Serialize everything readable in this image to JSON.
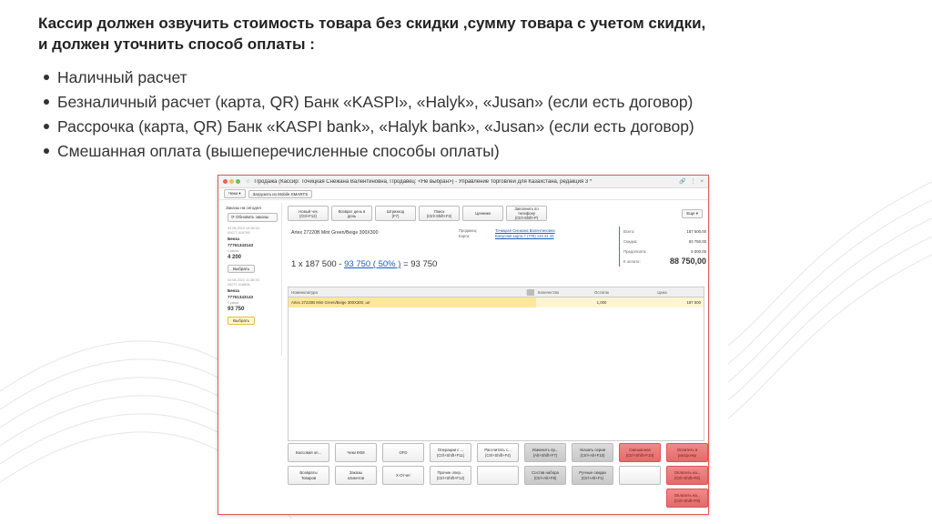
{
  "slide": {
    "title_line1": "Кассир должен озвучить стоимость товара без скидки ,сумму товара с учетом скидки,",
    "title_line2": "и должен уточнить способ оплаты :",
    "bullets": [
      "Наличный расчет",
      "Безналичный расчет (карта, QR) Банк «KASPI», «Halyk», «Jusan» (если есть договор)",
      "Рассрочка (карта, QR) Банк «KASPI bank», «Halyk bank», «Jusan» (если есть договор)",
      "Смешанная оплата (вышеперечисленные способы оплаты)"
    ]
  },
  "window": {
    "title": "Продажа (Кассир: Точицкая Снежана Валентиновна, Продавец: <Не выбран>) - Управление торговлей для Казахстана, редакция 3 *",
    "toolbar": {
      "checks": "Чеки ▾",
      "load_mobile": "Загрузить из Mobile SMARTS"
    },
    "left": {
      "title": "Заказы на сегодня",
      "refresh": "⟳  Обновить заказы",
      "orders": [
        {
          "meta1": "03.08.2022 10:36:54",
          "meta2": "00077-018795",
          "client": "Бекза",
          "phone": "77761343143",
          "sum_label": "Сумма",
          "sum": "4 200",
          "button": "Выбрать"
        },
        {
          "meta1": "03.08.2022 11:36:33",
          "meta2": "00077-018808",
          "client": "Бекза",
          "phone": "77761343143",
          "sum_label": "Сумма",
          "sum": "93 750",
          "button": "Выбрать"
        }
      ]
    },
    "commands": [
      {
        "l1": "Новый чек",
        "l2": "(Ctrl+F12)"
      },
      {
        "l1": "Возврат день в",
        "l2": "день"
      },
      {
        "l1": "Штрихкод",
        "l2": "(F7)"
      },
      {
        "l1": "Поиск",
        "l2": "(Ctrl+Shift+F2)"
      },
      {
        "l1": "Ценники",
        "l2": ""
      },
      {
        "l1": "Заполнить по телефону",
        "l2": "(Ctrl+Shift+P)"
      }
    ],
    "more": "Еще ▾",
    "product": "Artex 27220B Mint Green/Beige 300X300",
    "seller": {
      "seller_label": "Продавец:",
      "seller_value": "Точицкая Снежана Валентиновна",
      "card_label": "Карта:",
      "card_value": "Бонусная карта 7 (778) 134 31 43"
    },
    "calc": {
      "prefix": "1 x 187 500 - ",
      "discount": "93 750 ( 50% )",
      "suffix": " = 93 750"
    },
    "totals": [
      {
        "k": "Всего:",
        "v": "187 500,00"
      },
      {
        "k": "Скидка:",
        "v": "93 750,00"
      },
      {
        "k": "Предоплата:",
        "v": "5 000,00"
      },
      {
        "k": "К оплате:",
        "v": "88 750,00"
      }
    ],
    "grid": {
      "headers": [
        "Номенклатура",
        "Количество",
        "Остаток",
        "Цена"
      ],
      "row": {
        "name": "Artex 27220B Mint Green/Beige 300X300, шт",
        "qty": "",
        "rest": "1,000",
        "price": "187 500"
      }
    },
    "actions": [
      {
        "l1": "Кассовая оп...",
        "l2": "",
        "style": "normal"
      },
      {
        "l1": "Чеки ККМ",
        "l2": "",
        "style": "normal"
      },
      {
        "l1": "OFD",
        "l2": "",
        "style": "normal"
      },
      {
        "l1": "Операции с ...",
        "l2": "(Ctrl+Shift+F11)",
        "style": "normal"
      },
      {
        "l1": "Рассчитать с...",
        "l2": "(Ctrl+Shift+F4)",
        "style": "normal"
      },
      {
        "l1": "Изменить пр...",
        "l2": "(Alt+Shift+F7)",
        "style": "grey"
      },
      {
        "l1": "Указать серии",
        "l2": "(Ctrl+Alt+F10)",
        "style": "grey"
      },
      {
        "l1": "Смешанная",
        "l2": "(Ctrl+Shift+F10)",
        "style": "red"
      },
      {
        "l1": "Оплатить в",
        "l2": "рассрочку",
        "style": "red"
      },
      {
        "l1": "Возвраты",
        "l2": "Товаров",
        "style": "normal"
      },
      {
        "l1": "Заказы",
        "l2": "клиентов",
        "style": "normal"
      },
      {
        "l1": "X-Отчет",
        "l2": "",
        "style": "normal"
      },
      {
        "l1": "Прочие опер...",
        "l2": "(Ctrl+Shift+F12)",
        "style": "normal"
      },
      {
        "l1": "",
        "l2": "",
        "style": "normal"
      },
      {
        "l1": "Состав набора",
        "l2": "(Ctrl+Alt+F8)",
        "style": "grey"
      },
      {
        "l1": "Ручные скидки",
        "l2": "(Ctrl+Alt+F1)",
        "style": "grey"
      },
      {
        "l1": "",
        "l2": "",
        "style": "normal"
      },
      {
        "l1": "Оплатить на...",
        "l2": "(Ctrl+Shift+F8)",
        "style": "red"
      },
      {
        "l1": "Оплатить на...",
        "l2": "(Ctrl+Shift+F9)",
        "style": "red"
      }
    ]
  }
}
